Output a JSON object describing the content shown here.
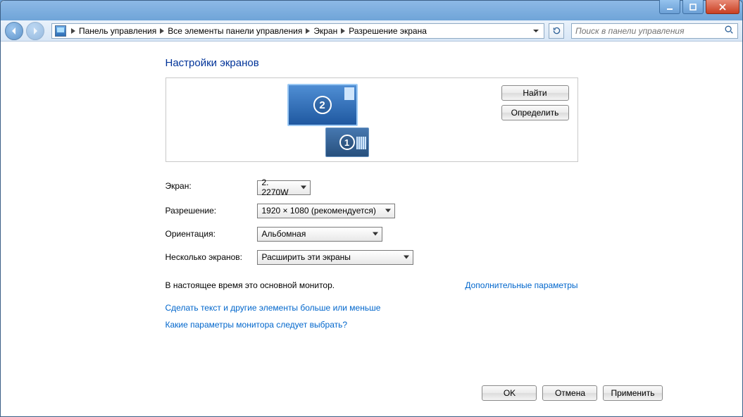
{
  "titlebar": {},
  "nav": {
    "crumbs": {
      "c0": "Панель управления",
      "c1": "Все элементы панели управления",
      "c2": "Экран",
      "c3": "Разрешение экрана"
    },
    "search_placeholder": "Поиск в панели управления"
  },
  "page": {
    "title": "Настройки экранов",
    "find": "Найти",
    "identify": "Определить",
    "fields": {
      "screen_label": "Экран:",
      "screen_value": "2. 2270W",
      "resolution_label": "Разрешение:",
      "resolution_value": "1920 × 1080 (рекомендуется)",
      "orientation_label": "Ориентация:",
      "orientation_value": "Альбомная",
      "multi_label": "Несколько экранов:",
      "multi_value": "Расширить эти экраны"
    },
    "status_text": "В настоящее время это основной монитор.",
    "advanced_link": "Дополнительные параметры",
    "link_textsize": "Сделать текст и другие элементы больше или меньше",
    "link_help": "Какие параметры монитора следует выбрать?",
    "monitor_labels": {
      "m1": "1",
      "m2": "2"
    }
  },
  "footer": {
    "ok": "OK",
    "cancel": "Отмена",
    "apply": "Применить"
  }
}
